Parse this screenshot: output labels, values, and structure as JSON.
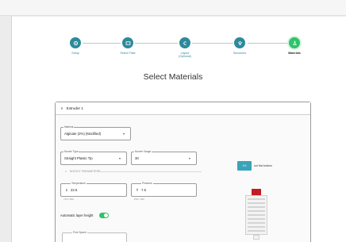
{
  "colors": {
    "step": "#2d8a9a",
    "active_step": "#2fc36a",
    "toggle_on": "#2fc36a",
    "well_button": "#3aa3b8",
    "plate_accent": "#c21d24"
  },
  "stepper": {
    "steps": [
      {
        "label": "Setup",
        "icon": "gear-icon",
        "state": "done"
      },
      {
        "label": "Select Plate",
        "icon": "plate-icon",
        "state": "done"
      },
      {
        "label": "Layout\n(Optional)",
        "icon": "layout-icon",
        "state": "done"
      },
      {
        "label": "Structures",
        "icon": "structure-icon",
        "state": "done"
      },
      {
        "label": "Materials",
        "icon": "flask-icon",
        "state": "active"
      }
    ]
  },
  "page": {
    "title": "Select Materials"
  },
  "extruder": {
    "header": "Extruder 1",
    "material": {
      "label": "Material",
      "value": "Alginate (2%) (Modified)"
    },
    "nozzle_type": {
      "label": "Nozzle Type",
      "value": "Straight Plastic Tip"
    },
    "nozzle_gauge": {
      "label": "Nozzle Gauge",
      "value": "30"
    },
    "section": "NOZZLE PARAMETERS",
    "temperature": {
      "label": "Temperature",
      "value": "22.5",
      "helper": "TC4: 65C"
    },
    "pressure": {
      "label": "Pressure",
      "value": "7.5",
      "helper": "PS1: 100"
    },
    "auto_layer": {
      "label": "Automatic layer height",
      "on": true
    },
    "print_speed": {
      "label": "Print Speed"
    }
  },
  "well": {
    "button": "1%",
    "label": "out flat bottom"
  }
}
